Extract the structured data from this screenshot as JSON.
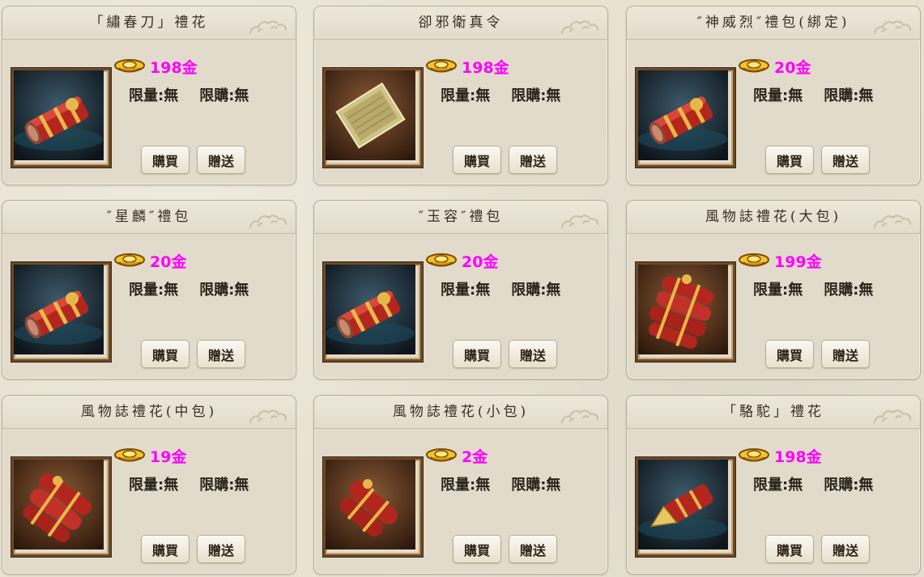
{
  "labels": {
    "limit_qty": "限量:無",
    "limit_buy": "限購:無",
    "buy": "購買",
    "gift": "贈送"
  },
  "colors": {
    "price": "#ff00ff",
    "card_bg": "#e2dbcb",
    "frame": "#6b4a28"
  },
  "items": [
    {
      "title": "「繡春刀」禮花",
      "price": "198金",
      "icon": "single-firecracker-icon"
    },
    {
      "title": "卻邪衛真令",
      "price": "198金",
      "icon": "token-scroll-icon"
    },
    {
      "title": "″神威烈″禮包(綁定)",
      "price": "20金",
      "icon": "single-firecracker-icon"
    },
    {
      "title": "″星麟″禮包",
      "price": "20金",
      "icon": "single-firecracker-icon"
    },
    {
      "title": "″玉容″禮包",
      "price": "20金",
      "icon": "single-firecracker-icon"
    },
    {
      "title": "風物誌禮花(大包)",
      "price": "199金",
      "icon": "large-firecracker-bundle-icon"
    },
    {
      "title": "風物誌禮花(中包)",
      "price": "19金",
      "icon": "medium-firecracker-bundle-icon"
    },
    {
      "title": "風物誌禮花(小包)",
      "price": "2金",
      "icon": "small-firecracker-bundle-icon"
    },
    {
      "title": "「駱駝」禮花",
      "price": "198金",
      "icon": "camel-firecracker-icon"
    }
  ]
}
